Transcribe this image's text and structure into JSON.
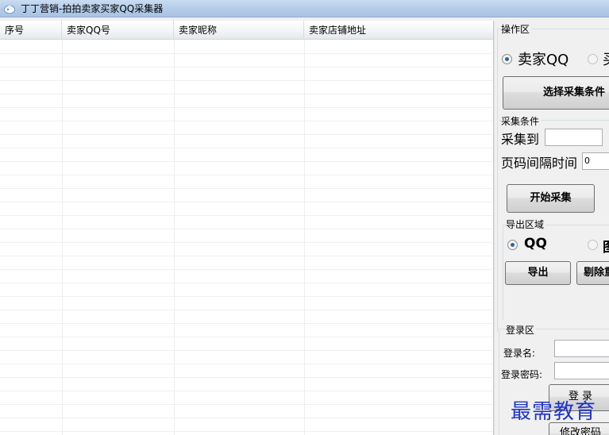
{
  "window": {
    "title": "丁丁营销-拍拍卖家买家QQ采集器",
    "app_icon": "cloud-app-icon"
  },
  "table": {
    "columns": [
      "序号",
      "卖家QQ号",
      "卖家昵称",
      "卖家店铺地址"
    ],
    "rows": []
  },
  "operation_area": {
    "title": "操作区",
    "mode_options": [
      {
        "label": "卖家QQ",
        "selected": true
      },
      {
        "label": "买",
        "selected": false
      }
    ],
    "select_conditions_button": "选择采集条件",
    "conditions_group": {
      "title": "采集条件",
      "collect_to_label": "采集到",
      "collect_to_value": "",
      "interval_label": "页码间隔时间",
      "interval_value": "0"
    },
    "start_button": "开始采集",
    "export_group": {
      "title": "导出区域",
      "options": [
        {
          "label": "QQ",
          "selected": true
        },
        {
          "label": "图",
          "selected": false
        }
      ],
      "export_button": "导出",
      "remove_dup_button": "剔除重"
    }
  },
  "login_area": {
    "title": "登录区",
    "username_label": "登录名:",
    "username_value": "",
    "password_label": "登录密码:",
    "password_value": "",
    "login_button": "登 录",
    "change_password_button": "修改密码"
  },
  "watermark": "最需教育",
  "colors": {
    "accent_radio": "#2b64a8",
    "watermark": "#1f34c8",
    "titlebar": "#b4cce9"
  }
}
